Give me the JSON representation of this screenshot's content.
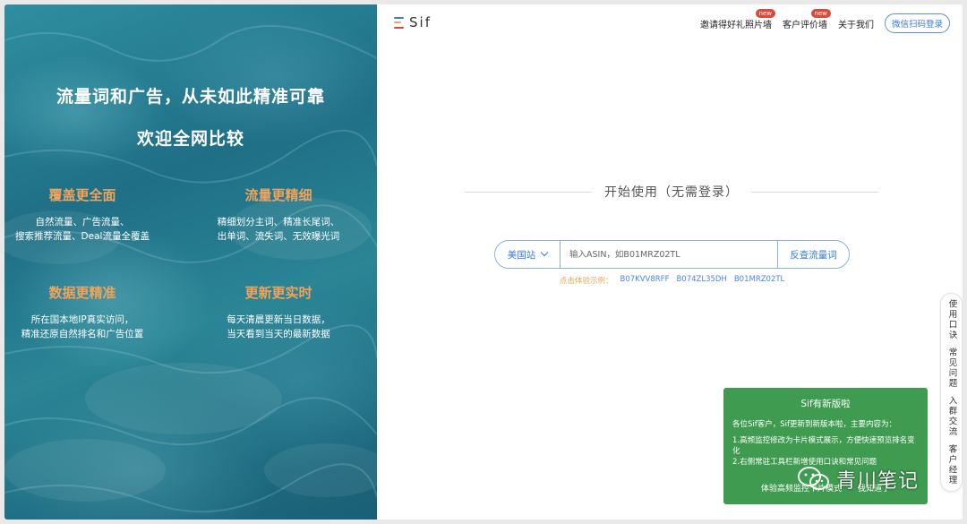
{
  "hero": {
    "title": "流量词和广告，从未如此精准可靠",
    "subtitle": "欢迎全网比较",
    "features": [
      {
        "heading": "覆盖更全面",
        "lines": [
          "自然流量、广告流量、",
          "搜索推荐流量、Deal流量全覆盖"
        ]
      },
      {
        "heading": "流量更精细",
        "lines": [
          "精细划分主词、精准长尾词、",
          "出单词、流失词、无效曝光词"
        ]
      },
      {
        "heading": "数据更精准",
        "lines": [
          "所在国本地IP真实访问，",
          "精准还原自然排名和广告位置"
        ]
      },
      {
        "heading": "更新更实时",
        "lines": [
          "每天清晨更新当日数据，",
          "当天看到当天的最新数据"
        ]
      }
    ]
  },
  "header": {
    "logo_text": "Sif",
    "nav": [
      {
        "label": "邀请得好礼照片墙",
        "badge": "new"
      },
      {
        "label": "客户评价墙",
        "badge": "new"
      },
      {
        "label": "关于我们",
        "badge": ""
      }
    ],
    "login_label": "微信扫码登录"
  },
  "main": {
    "start_label": "开始使用（无需登录）",
    "site_select": "美国站",
    "search_placeholder": "输入ASIN，如B01MRZ02TL",
    "query_button": "反查流量词",
    "examples_label": "点击体验示例：",
    "examples": [
      "B07KVV8RFF",
      "B074ZL35DH",
      "B01MRZ02TL"
    ]
  },
  "sidebar": {
    "items": [
      "使用口诀",
      "常见问题",
      "入群交流",
      "客户经理"
    ]
  },
  "notice": {
    "title": "Sif有新版啦",
    "intro": "各位Sif客户，Sif更新到新版本啦，主要内容为：",
    "item1": "1.高频监控修改为卡片模式展示，方便快速预览排名变化",
    "item2": "2.右侧常驻工具栏新增使用口诀和常见问题",
    "action_try": "体验高频监控卡片模式",
    "action_ok": "我知道了"
  },
  "watermark": {
    "text": "青川笔记"
  },
  "colors": {
    "accent_blue": "#3b7be0",
    "feature_orange": "#f0a35a",
    "notice_green": "#3f9b4f",
    "badge_red": "#d94a3a"
  }
}
